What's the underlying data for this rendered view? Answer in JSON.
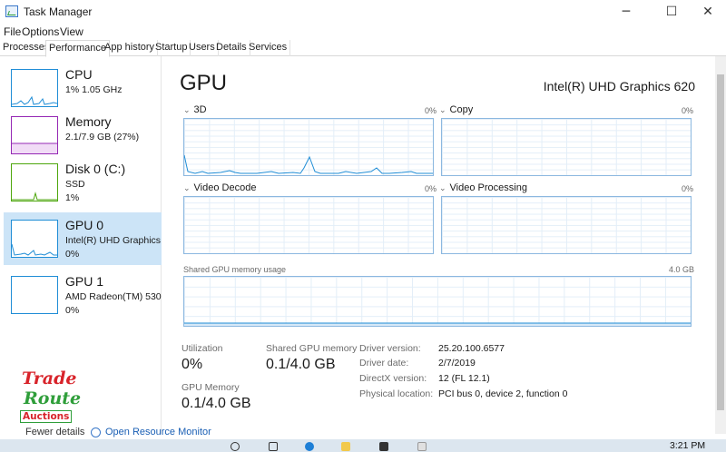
{
  "window": {
    "title": "Task Manager",
    "min": "─",
    "max": "☐",
    "close": "✕"
  },
  "menu": [
    "File",
    "Options",
    "View"
  ],
  "tabs": [
    "Processes",
    "Performance",
    "App history",
    "Startup",
    "Users",
    "Details",
    "Services"
  ],
  "active_tab": "Performance",
  "sidebar": [
    {
      "title": "CPU",
      "line1": "1%  1.05 GHz",
      "line2": "",
      "color": "#1f8dd6"
    },
    {
      "title": "Memory",
      "line1": "2.1/7.9 GB (27%)",
      "line2": "",
      "color": "#9528b4"
    },
    {
      "title": "Disk 0 (C:)",
      "line1": "SSD",
      "line2": "1%",
      "color": "#4da60c"
    },
    {
      "title": "GPU 0",
      "line1": "Intel(R) UHD Graphics 620",
      "line2": "0%",
      "color": "#1f8dd6"
    },
    {
      "title": "GPU 1",
      "line1": "AMD Radeon(TM) 530",
      "line2": "0%",
      "color": "#1f8dd6"
    }
  ],
  "selected_item": "GPU 0",
  "main": {
    "title": "GPU",
    "device": "Intel(R) UHD Graphics 620",
    "graphs": [
      {
        "name": "3D",
        "pct": "0%"
      },
      {
        "name": "Copy",
        "pct": "0%"
      },
      {
        "name": "Video Decode",
        "pct": "0%"
      },
      {
        "name": "Video Processing",
        "pct": "0%"
      }
    ],
    "shared_label": "Shared GPU memory usage",
    "shared_max": "4.0 GB",
    "stats": {
      "utilization_label": "Utilization",
      "utilization_value": "0%",
      "shared_label": "Shared GPU memory",
      "shared_value": "0.1/4.0 GB",
      "gpumem_label": "GPU Memory",
      "gpumem_value": "0.1/4.0 GB"
    },
    "info": [
      {
        "label": "Driver version:",
        "value": "25.20.100.6577"
      },
      {
        "label": "Driver date:",
        "value": "2/7/2019"
      },
      {
        "label": "DirectX version:",
        "value": "12 (FL 12.1)"
      },
      {
        "label": "Physical location:",
        "value": "PCI bus 0, device 2, function 0"
      }
    ]
  },
  "footer": {
    "fewer": "Fewer details",
    "resmon": "Open Resource Monitor"
  },
  "logo": {
    "line1": "Trade",
    "line2": "Route",
    "line3": "Auctions"
  },
  "taskbar": {
    "time": "3:21 PM"
  },
  "colors": {
    "graph_border": "#8cb8e0",
    "graph_line": "#1f8dd6",
    "selected_bg": "#cce4f7"
  }
}
